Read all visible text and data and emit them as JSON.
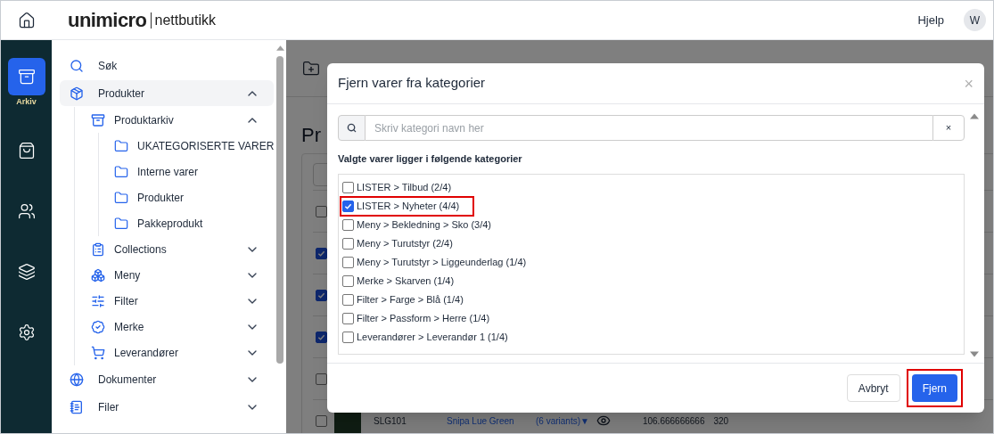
{
  "topbar": {
    "logo_main": "unimicro",
    "logo_sub": "nettbutikk",
    "help": "Hjelp",
    "avatar": "W"
  },
  "rail": [
    {
      "label": "Arkiv",
      "selected": true
    },
    {
      "selected": false
    },
    {
      "selected": false
    },
    {
      "selected": false
    },
    {
      "selected": false
    }
  ],
  "sidebar": {
    "items": [
      {
        "label": "Søk",
        "selected": false
      },
      {
        "label": "Produkter",
        "selected": true,
        "expanded": true,
        "children": [
          {
            "label": "Produktarkiv",
            "expanded": true,
            "children": [
              {
                "label": "UKATEGORISERTE VARER"
              },
              {
                "label": "Interne varer"
              },
              {
                "label": "Produkter"
              },
              {
                "label": "Pakkeprodukt"
              }
            ]
          },
          {
            "label": "Collections",
            "expanded": false
          },
          {
            "label": "Meny",
            "expanded": false
          },
          {
            "label": "Filter",
            "expanded": false
          },
          {
            "label": "Merke",
            "expanded": false
          },
          {
            "label": "Leverandører",
            "expanded": false
          }
        ]
      },
      {
        "label": "Dokumenter",
        "selected": false,
        "expanded": false
      },
      {
        "label": "Filer",
        "selected": false,
        "expanded": false
      }
    ]
  },
  "background": {
    "heading": "Pr",
    "rows": [
      {
        "checked": false
      },
      {
        "checked": true
      },
      {
        "checked": true
      },
      {
        "checked": true
      },
      {
        "checked": false
      },
      {
        "checked": false,
        "sku": "SLG101",
        "name": "Snipa Lue Green",
        "variants": "(6 variants)▼",
        "price": "106.666666666",
        "stock": "320"
      }
    ]
  },
  "dialog": {
    "title": "Fjern varer fra kategorier",
    "close": "×",
    "search": {
      "placeholder": "Skriv kategori navn her",
      "clear": "×"
    },
    "list_label": "Valgte varer ligger i følgende kategorier",
    "categories": [
      {
        "label": "LISTER > Tilbud (2/4)",
        "checked": false,
        "highlighted": false
      },
      {
        "label": "LISTER > Nyheter (4/4)",
        "checked": true,
        "highlighted": true
      },
      {
        "label": "Meny > Bekledning > Sko (3/4)",
        "checked": false,
        "highlighted": false
      },
      {
        "label": "Meny > Turutstyr (2/4)",
        "checked": false,
        "highlighted": false
      },
      {
        "label": "Meny > Turutstyr > Liggeunderlag (1/4)",
        "checked": false,
        "highlighted": false
      },
      {
        "label": "Merke > Skarven (1/4)",
        "checked": false,
        "highlighted": false
      },
      {
        "label": "Filter > Farge > Blå (1/4)",
        "checked": false,
        "highlighted": false
      },
      {
        "label": "Filter > Passform > Herre (1/4)",
        "checked": false,
        "highlighted": false
      },
      {
        "label": "Leverandører > Leverandør 1 (1/4)",
        "checked": false,
        "highlighted": false
      }
    ],
    "buttons": [
      {
        "label": "Avbryt",
        "kind": "secondary",
        "highlighted": false
      },
      {
        "label": "Fjern",
        "kind": "primary",
        "highlighted": true
      }
    ]
  }
}
